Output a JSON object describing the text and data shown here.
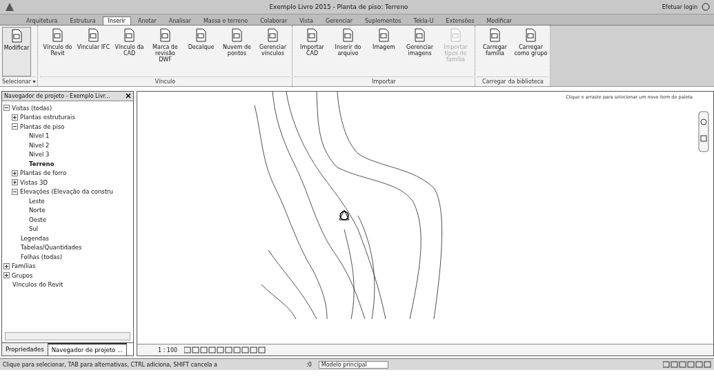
{
  "window": {
    "title": "Exemplo Livro 2015 - Planta de piso: Terreno",
    "login": "Efetuar login"
  },
  "tabs": [
    {
      "label": "Arquitetura",
      "selected": false
    },
    {
      "label": "Estrutura",
      "selected": false
    },
    {
      "label": "Inserir",
      "selected": true
    },
    {
      "label": "Anotar",
      "selected": false
    },
    {
      "label": "Analisar",
      "selected": false
    },
    {
      "label": "Massa e terreno",
      "selected": false
    },
    {
      "label": "Colaborar",
      "selected": false
    },
    {
      "label": "Vista",
      "selected": false
    },
    {
      "label": "Gerenciar",
      "selected": false
    },
    {
      "label": "Suplementos",
      "selected": false
    },
    {
      "label": "Tekla-U",
      "selected": false
    },
    {
      "label": "Extensões",
      "selected": false
    },
    {
      "label": "Modificar",
      "selected": false
    }
  ],
  "ribbon": [
    {
      "title": "Selecionar ▾",
      "buttons": [
        {
          "label": "Modificar",
          "disabled": false
        }
      ]
    },
    {
      "title": "Vínculo",
      "buttons": [
        {
          "label": "Vínculo do Revit",
          "disabled": false
        },
        {
          "label": "Vincular IFC",
          "disabled": false
        },
        {
          "label": "Vínculo da CAD",
          "disabled": false
        },
        {
          "label": "Marca de revisão DWF",
          "disabled": false
        },
        {
          "label": "Decalque",
          "disabled": false
        },
        {
          "label": "Nuvem de pontos",
          "disabled": false
        },
        {
          "label": "Gerenciar vínculos",
          "disabled": false
        }
      ]
    },
    {
      "title": "Importar",
      "buttons": [
        {
          "label": "Importar CAD",
          "disabled": false
        },
        {
          "label": "Inserir do arquivo",
          "disabled": false
        },
        {
          "label": "Imagem",
          "disabled": false
        },
        {
          "label": "Gerenciar imagens",
          "disabled": false
        },
        {
          "label": "Importar tipos de família",
          "disabled": true
        }
      ]
    },
    {
      "title": "Carregar da biblioteca",
      "buttons": [
        {
          "label": "Carregar família",
          "disabled": false
        },
        {
          "label": "Carregar como grupo",
          "disabled": false
        }
      ]
    }
  ],
  "navigator": {
    "title": "Navegador de projeto - Exemplo Livr...",
    "tree": [
      {
        "label": "Vistas (todas)",
        "expanded": true,
        "selected": false,
        "children": [
          {
            "label": "Plantas estruturais",
            "expanded": false,
            "selected": false
          },
          {
            "label": "Plantas de piso",
            "expanded": true,
            "selected": false,
            "children": [
              {
                "label": "Nível 1",
                "selected": false
              },
              {
                "label": "Nível 2",
                "selected": false
              },
              {
                "label": "Nível 3",
                "selected": false
              },
              {
                "label": "Terreno",
                "selected": true
              }
            ]
          },
          {
            "label": "Plantas de forro",
            "expanded": false,
            "selected": false
          },
          {
            "label": "Vistas 3D",
            "expanded": false,
            "selected": false
          },
          {
            "label": "Elevações (Elevação da constru",
            "expanded": true,
            "selected": false,
            "children": [
              {
                "label": "Leste",
                "selected": false
              },
              {
                "label": "Norte",
                "selected": false
              },
              {
                "label": "Oeste",
                "selected": false
              },
              {
                "label": "Sul",
                "selected": false
              }
            ]
          },
          {
            "label": "Legendas",
            "selected": false
          },
          {
            "label": "Tabelas/Quantidades",
            "selected": false
          },
          {
            "label": "Folhas (todas)",
            "selected": false
          }
        ]
      },
      {
        "label": "Famílias",
        "expanded": false,
        "selected": false
      },
      {
        "label": "Grupos",
        "expanded": false,
        "selected": false
      },
      {
        "label": "Vínculos do Revit",
        "selected": false
      }
    ],
    "bottom_tabs": [
      {
        "label": "Propriedades",
        "selected": false
      },
      {
        "label": "Navegador de projeto ...",
        "selected": true
      }
    ]
  },
  "view": {
    "hint": "Clique e arraste para selecionar um novo item de paleta",
    "scale": "1 : 100"
  },
  "status_bar": {
    "message": "Clique para selecionar, TAB para alternativas, CTRL adiciona, SHIFT cancela a",
    "workset_count": ":0",
    "model": "Modelo principal"
  }
}
